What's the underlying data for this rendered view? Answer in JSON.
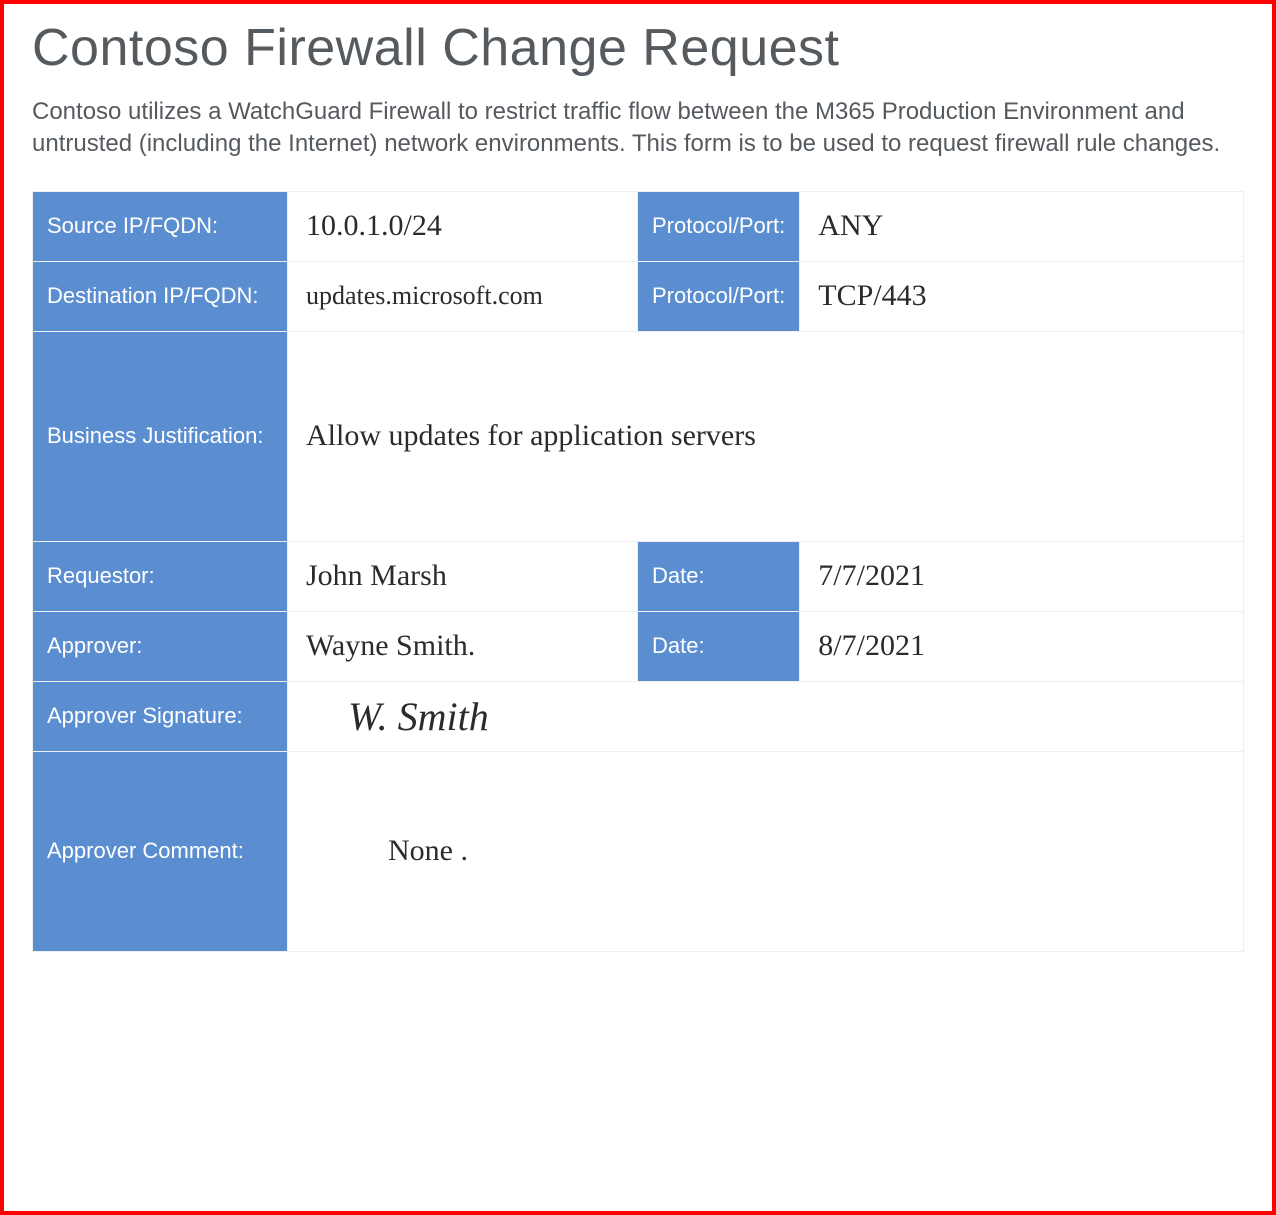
{
  "header": {
    "title": "Contoso Firewall Change Request",
    "intro": "Contoso utilizes a WatchGuard Firewall to restrict traffic flow between the M365 Production Environment and untrusted (including the Internet) network environments.  This form is to be used to request firewall rule changes."
  },
  "labels": {
    "source_ip": "Source IP/FQDN:",
    "dest_ip": "Destination IP/FQDN:",
    "protocol_port": "Protocol/Port:",
    "justification": "Business Justification:",
    "requestor": "Requestor:",
    "approver": "Approver:",
    "approver_sig": "Approver Signature:",
    "approver_comment": "Approver Comment:",
    "date": "Date:"
  },
  "values": {
    "source_ip": "10.0.1.0/24",
    "source_port": "ANY",
    "dest_ip": "updates.microsoft.com",
    "dest_port": "TCP/443",
    "justification": "Allow updates for application servers",
    "requestor": "John Marsh",
    "requestor_date": "7/7/2021",
    "approver": "Wayne Smith.",
    "approver_date": "8/7/2021",
    "approver_sig": "W. Smith",
    "approver_comment": "None ."
  }
}
